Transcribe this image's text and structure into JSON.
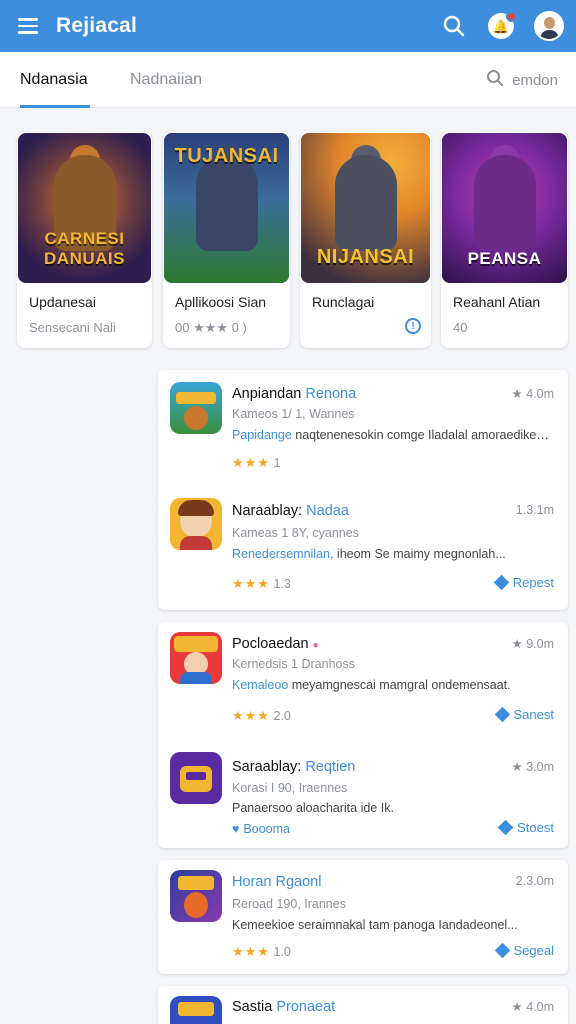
{
  "header": {
    "title": "Rejiacal",
    "colors": {
      "primary": "#3d8fde",
      "badge": "#e8453c"
    },
    "icons": [
      "menu-icon",
      "search-icon",
      "notification-icon",
      "avatar"
    ]
  },
  "tabs": {
    "active": "Ndanasia",
    "secondary": "Nadnaiian",
    "search_label": "emdon"
  },
  "featured": [
    {
      "name": "Updanesai",
      "sub": "Sensecani Nali",
      "art_text": "CARNESI DANUAIS",
      "colors": [
        "#2b1d4e",
        "#e2762a"
      ]
    },
    {
      "name": "Apllikoosi Sian",
      "sub": "00 ★★★ 0 )",
      "art_text": "TUJANSAI",
      "colors": [
        "#2d7a2f",
        "#2a3f7a"
      ]
    },
    {
      "name": "Runclagai",
      "sub": "",
      "art_text": "NIJANSAI",
      "colors": [
        "#e2852a",
        "#3a2f3f"
      ]
    },
    {
      "name": "Reahanl Atian",
      "sub": "40",
      "art_text": "PEANSA",
      "colors": [
        "#5a1e8a",
        "#c23fa8"
      ]
    }
  ],
  "apps": [
    {
      "name": "Anpiandan",
      "accent": "Renona",
      "meta": "★ 4.0m",
      "sub": "Kameos 1/ 1, Wannes",
      "desc_lead": "Papidange",
      "desc": " naqtenenesokin comge Iladalal amoraedikes...",
      "stars": "★★★",
      "rating": "1",
      "button": ""
    },
    {
      "name": "Naraablay:",
      "accent": "Nadaa",
      "meta": "1.3.1m",
      "sub": "Kameas 1 8Y, cyannes",
      "desc_lead": "Renedersemnilan,",
      "desc": " iheom Se maimy megnonlah...",
      "stars": "★★★",
      "rating": "1.3",
      "button": "Repest"
    },
    {
      "name": "Pocloaedan",
      "accent": "",
      "meta": "★ 9.0m",
      "sub": "Kernedsis 1 Dranhoss",
      "desc_lead": "Kemaleoo",
      "desc": " meyamgnescai mamgral ondemensaat.",
      "stars": "★★★",
      "rating": "2.0",
      "button": "Sanest"
    },
    {
      "name": "Saraablay:",
      "accent": "Reqtien",
      "meta": "★ 3.0m",
      "sub": "Korasi I 90, Iraennes",
      "desc_lead": "Panaersoo",
      "desc": " aloacharita ide Ik.",
      "stars": "",
      "rating": "Boooma",
      "button": "Stoest"
    },
    {
      "name": "",
      "accent": "Horan Rgaonl",
      "meta": "2.3.0m",
      "sub": "Reroad 190, Irannes",
      "desc_lead": "",
      "desc": "Kemeekioe seraimnakal tam panoga Iandadeonel...",
      "stars": "★★★",
      "rating": "1.0",
      "button": "Segeal"
    },
    {
      "name": "Sastia",
      "accent": "Pronaeat",
      "meta": "★ 4.0m",
      "sub": "",
      "desc_lead": "",
      "desc": "",
      "stars": "",
      "rating": "",
      "button": ""
    }
  ]
}
